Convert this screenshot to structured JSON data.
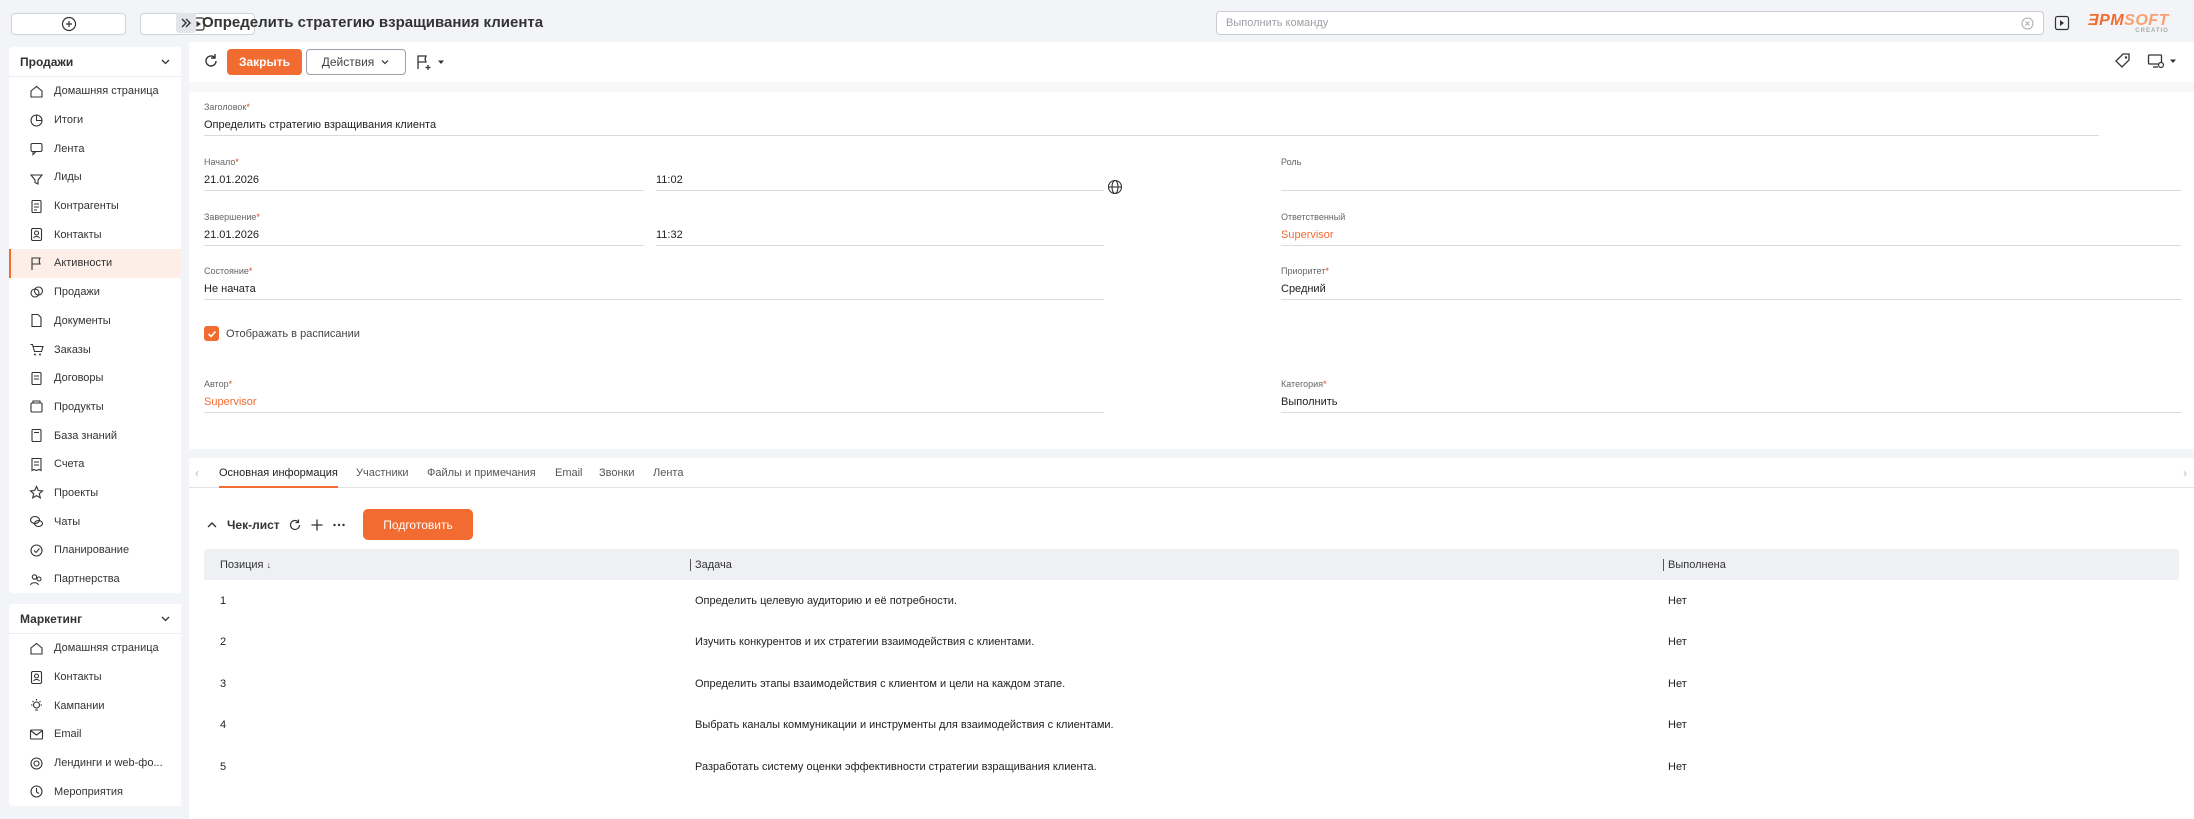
{
  "topbar": {
    "title": "Определить стратегию взращивания клиента",
    "command_placeholder": "Выполнить команду",
    "logo_main": "ƎPM",
    "logo_accent": "SOFT",
    "logo_sub": "CREATIO"
  },
  "sidebar": {
    "sections": [
      {
        "title": "Продажи",
        "items": [
          {
            "label": "Домашняя страница",
            "icon": "home-icon"
          },
          {
            "label": "Итоги",
            "icon": "chart-icon"
          },
          {
            "label": "Лента",
            "icon": "feed-icon"
          },
          {
            "label": "Лиды",
            "icon": "leads-icon"
          },
          {
            "label": "Контрагенты",
            "icon": "accounts-icon"
          },
          {
            "label": "Контакты",
            "icon": "contacts-icon"
          },
          {
            "label": "Активности",
            "icon": "flag-icon"
          },
          {
            "label": "Продажи",
            "icon": "coins-icon"
          },
          {
            "label": "Документы",
            "icon": "document-icon"
          },
          {
            "label": "Заказы",
            "icon": "cart-icon"
          },
          {
            "label": "Договоры",
            "icon": "contract-icon"
          },
          {
            "label": "Продукты",
            "icon": "product-icon"
          },
          {
            "label": "База знаний",
            "icon": "book-icon"
          },
          {
            "label": "Счета",
            "icon": "invoice-icon"
          },
          {
            "label": "Проекты",
            "icon": "star-icon"
          },
          {
            "label": "Чаты",
            "icon": "chat-icon"
          },
          {
            "label": "Планирование",
            "icon": "check-circle-icon"
          },
          {
            "label": "Партнерства",
            "icon": "partners-icon"
          }
        ]
      },
      {
        "title": "Маркетинг",
        "items": [
          {
            "label": "Домашняя страница",
            "icon": "home-icon"
          },
          {
            "label": "Контакты",
            "icon": "contacts-icon"
          },
          {
            "label": "Кампании",
            "icon": "campaign-icon"
          },
          {
            "label": "Email",
            "icon": "email-icon"
          },
          {
            "label": "Лендинги и web-фо...",
            "icon": "landing-icon"
          },
          {
            "label": "Мероприятия",
            "icon": "event-icon"
          }
        ]
      }
    ]
  },
  "toolbar": {
    "close_label": "Закрыть",
    "actions_label": "Действия"
  },
  "form": {
    "title": {
      "label": "Заголовок",
      "value": "Определить стратегию взращивания клиента"
    },
    "start": {
      "label": "Начало",
      "date": "21.01.2026",
      "time": "11:02"
    },
    "end": {
      "label": "Завершение",
      "date": "21.01.2026",
      "time": "11:32"
    },
    "status": {
      "label": "Состояние",
      "value": "Не начата"
    },
    "show_in_schedule": "Отображать в расписании",
    "author": {
      "label": "Автор",
      "value": "Supervisor"
    },
    "role": {
      "label": "Роль",
      "value": ""
    },
    "owner": {
      "label": "Ответственный",
      "value": "Supervisor"
    },
    "priority": {
      "label": "Приоритет",
      "value": "Средний"
    },
    "category": {
      "label": "Категория",
      "value": "Выполнить"
    },
    "required_mark": "*"
  },
  "tabs": [
    "Основная информация",
    "Участники",
    "Файлы и примечания",
    "Email",
    "Звонки",
    "Лента"
  ],
  "checklist": {
    "title": "Чек-лист",
    "prepare_label": "Подготовить",
    "columns": [
      "Позиция",
      "Задача",
      "Выполнена"
    ],
    "rows": [
      {
        "pos": "1",
        "task": "Определить целевую аудиторию и её потребности.",
        "done": "Нет"
      },
      {
        "pos": "2",
        "task": "Изучить конкурентов и их стратегии взаимодействия с клиентами.",
        "done": "Нет"
      },
      {
        "pos": "3",
        "task": "Определить этапы взаимодействия с клиентом и цели на каждом этапе.",
        "done": "Нет"
      },
      {
        "pos": "4",
        "task": "Выбрать каналы коммуникации и инструменты для взаимодействия с клиентами.",
        "done": "Нет"
      },
      {
        "pos": "5",
        "task": "Разработать систему оценки эффективности стратегии взращивания клиента.",
        "done": "Нет"
      }
    ]
  },
  "colors": {
    "accent": "#f26b30",
    "bg": "#f3f4f7"
  }
}
